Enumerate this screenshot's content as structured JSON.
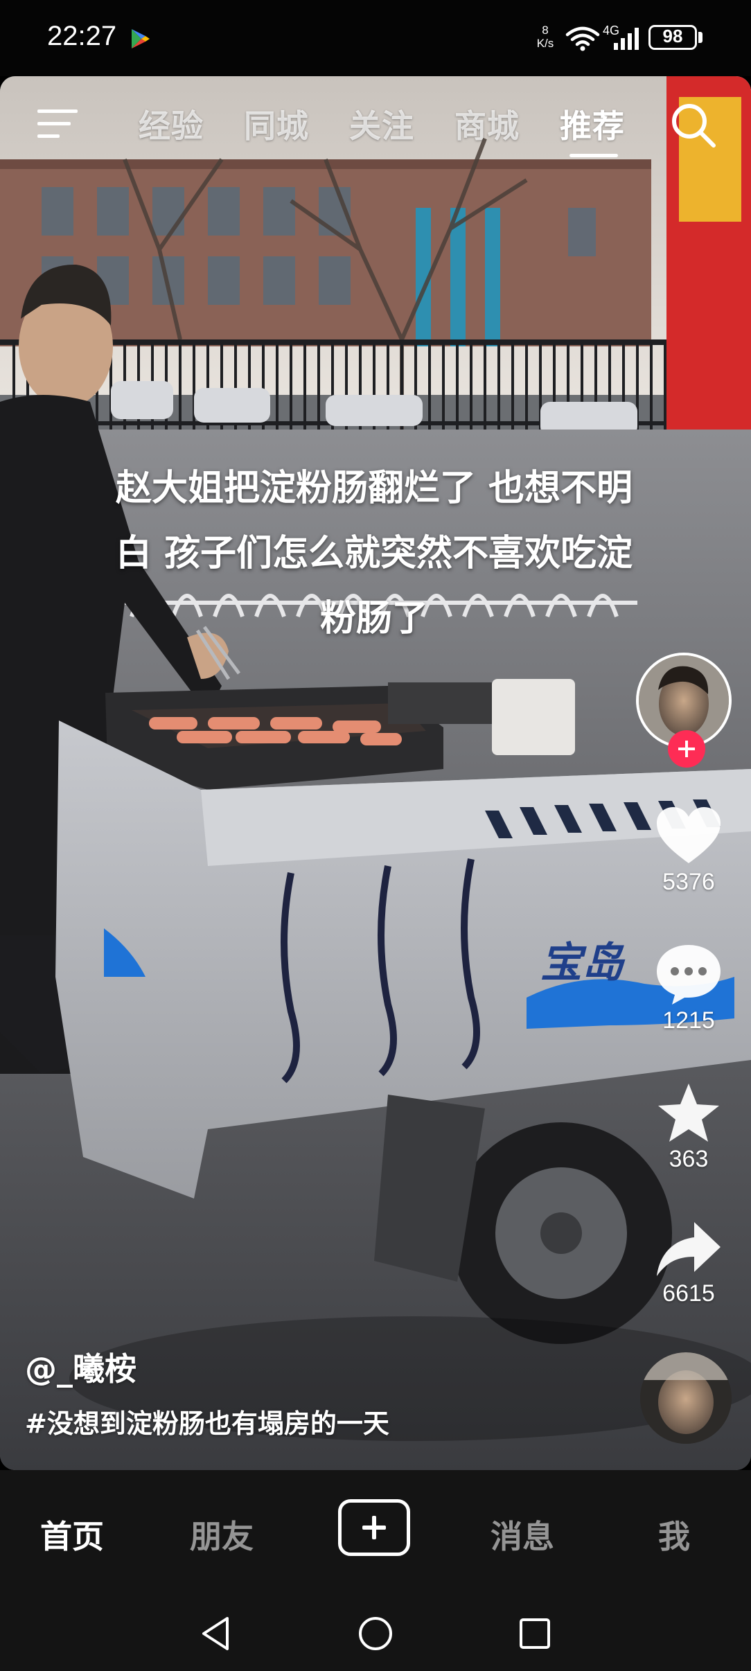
{
  "status_bar": {
    "time": "22:27",
    "net_speed_value": "8",
    "net_speed_unit": "K/s",
    "network_type": "4G",
    "battery": "98"
  },
  "top_nav": {
    "tabs": [
      {
        "label": "经验"
      },
      {
        "label": "同城"
      },
      {
        "label": "关注"
      },
      {
        "label": "商城"
      },
      {
        "label": "推荐"
      }
    ],
    "active_tab": "推荐"
  },
  "video": {
    "caption_lines": [
      "赵大姐把淀粉肠翻烂了 也想不明",
      "白 孩子们怎么就突然不喜欢吃淀",
      "粉肠了"
    ],
    "author": "@_曦桉",
    "hashtag": "#没想到淀粉肠也有塌房的一天",
    "cart_brand": "宝岛",
    "likes": "5376",
    "comments": "1215",
    "favorites": "363",
    "shares": "6615"
  },
  "bottom_tabs": {
    "home": "首页",
    "friends": "朋友",
    "messages": "消息",
    "me": "我"
  },
  "colors": {
    "accent_red": "#fe2c55",
    "bar_background": "#141414"
  },
  "icons": [
    "app-store-icon",
    "wifi-icon",
    "signal-icon",
    "menu-icon",
    "search-icon",
    "plus-icon",
    "heart-icon",
    "comment-icon",
    "star-icon",
    "share-icon",
    "back-icon",
    "home-circle-icon",
    "recents-icon"
  ]
}
